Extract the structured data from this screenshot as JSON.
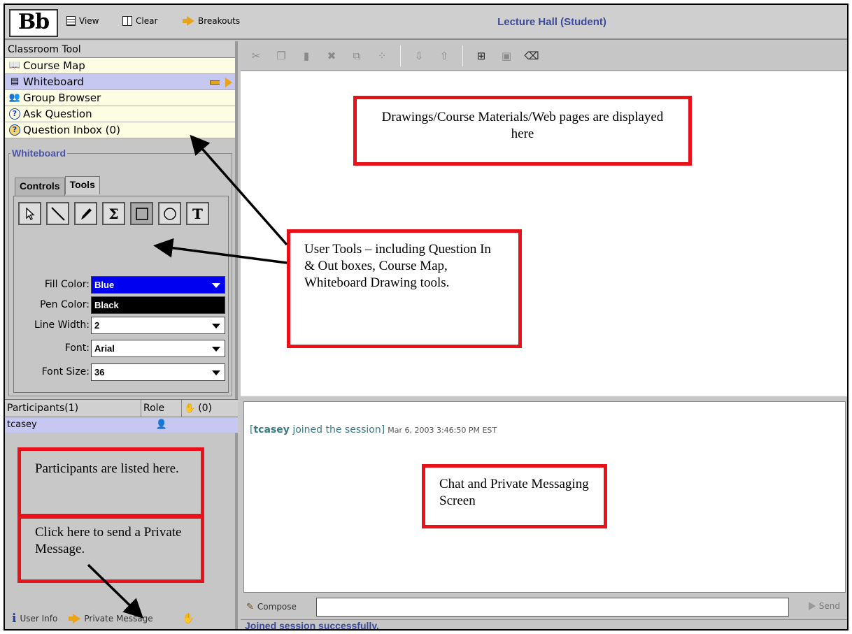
{
  "app": {
    "logo": "Bb",
    "toolbar": [
      {
        "label": "View",
        "icon": "grid-view-icon"
      },
      {
        "label": "Clear",
        "icon": "clear-icon"
      },
      {
        "label": "Breakouts",
        "icon": "arrow-right-icon"
      }
    ],
    "title": "Lecture Hall (Student)"
  },
  "classroom": {
    "header": "Classroom Tool",
    "items": [
      {
        "label": "Course Map",
        "icon": "book-icon"
      },
      {
        "label": "Whiteboard",
        "icon": "whiteboard-icon"
      },
      {
        "label": "Group Browser",
        "icon": "group-icon"
      },
      {
        "label": "Ask Question",
        "icon": "question-icon"
      },
      {
        "label": "Question Inbox (0)",
        "icon": "question-inbox-icon"
      }
    ],
    "selected": "Whiteboard"
  },
  "whiteboard_panel": {
    "legend": "Whiteboard",
    "tabs": [
      "Controls",
      "Tools"
    ],
    "active_tab": "Tools",
    "tools": [
      "select-arrow",
      "line",
      "pen",
      "sigma",
      "rectangle",
      "circle",
      "text"
    ],
    "text_tool_glyph": "T",
    "sigma_glyph": "Σ",
    "fill_color": {
      "label": "Fill Color:",
      "value": "Blue"
    },
    "pen_color": {
      "label": "Pen Color:",
      "value": "Black"
    },
    "line_width": {
      "label": "Line Width:",
      "value": "2"
    },
    "font": {
      "label": "Font:",
      "value": "Arial"
    },
    "font_size": {
      "label": "Font Size:",
      "value": "36"
    }
  },
  "participants": {
    "header": "Participants(1)",
    "role_header": "Role",
    "hand_count": "(0)",
    "rows": [
      {
        "name": "tcasey"
      }
    ]
  },
  "left_bottom": {
    "user_info": "User Info",
    "private_message": "Private Message"
  },
  "chat": {
    "user": "tcasey",
    "message": " joined the session]",
    "timestamp": "Mar 6, 2003 3:46:50 PM EST"
  },
  "compose": {
    "compose_label": "Compose",
    "send_label": "Send",
    "input_value": ""
  },
  "status": "Joined session successfully.",
  "annotations": {
    "display_area": "Drawings/Course Materials/Web pages are displayed here",
    "user_tools": "User Tools – including Question In & Out boxes, Course Map, Whiteboard Drawing tools.",
    "participants_listed": "Participants are listed here.",
    "private_msg": "Click here to send a Private Message.",
    "chat_screen": "Chat and Private Messaging Screen"
  }
}
